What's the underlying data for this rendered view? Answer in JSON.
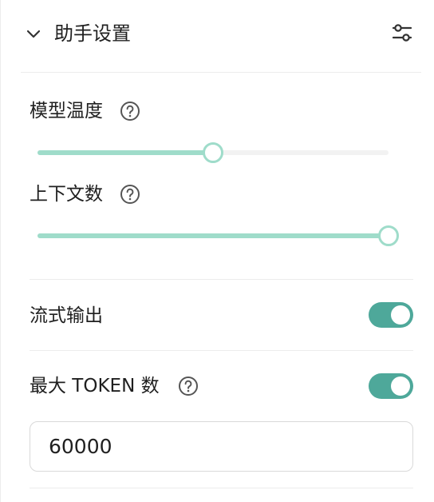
{
  "header": {
    "title": "助手设置"
  },
  "temperature": {
    "label": "模型温度",
    "value_fraction": 0.5
  },
  "context": {
    "label": "上下文数",
    "value_fraction": 1.0
  },
  "stream": {
    "label": "流式输出",
    "enabled": true
  },
  "max_tokens": {
    "label": "最大 TOKEN 数",
    "enabled": true,
    "value": "60000"
  },
  "colors": {
    "accent": "#4ea89a",
    "slider_fill": "#9fdcca",
    "rail": "#f2f2f2",
    "divider": "#ececec"
  }
}
